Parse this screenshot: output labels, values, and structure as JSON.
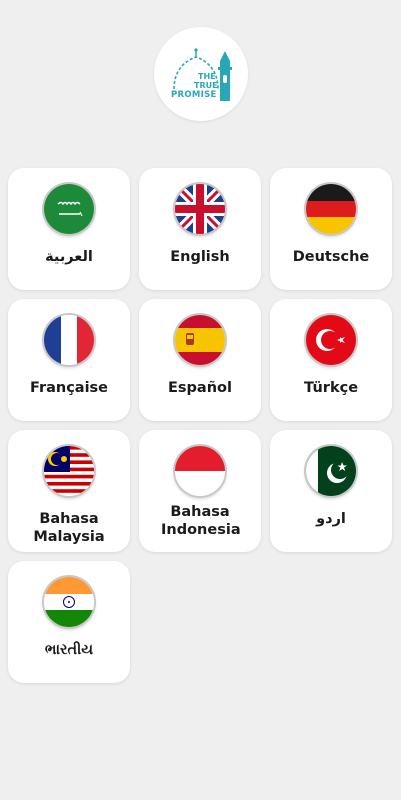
{
  "app": {
    "logo": {
      "name": "THE TRUE PROMISE",
      "line1": "THE",
      "line2": "TRUE",
      "line3": "PROMISE"
    }
  },
  "languages": [
    {
      "label": "العربية",
      "flag": "saudi-arabia-flag-icon"
    },
    {
      "label": "English",
      "flag": "uk-flag-icon"
    },
    {
      "label": "Deutsche",
      "flag": "germany-flag-icon"
    },
    {
      "label": "Française",
      "flag": "france-flag-icon"
    },
    {
      "label": "Español",
      "flag": "spain-flag-icon"
    },
    {
      "label": "Türkçe",
      "flag": "turkey-flag-icon"
    },
    {
      "label": "Bahasa Malaysia",
      "flag": "malaysia-flag-icon"
    },
    {
      "label": "Bahasa Indonesia",
      "flag": "indonesia-flag-icon"
    },
    {
      "label": "اردو",
      "flag": "pakistan-flag-icon"
    },
    {
      "label": "ભારતીય",
      "flag": "india-flag-icon"
    }
  ],
  "colors": {
    "background": "#efefef",
    "card": "#ffffff",
    "brand": "#2aa7b6",
    "text": "#1b1b1b"
  }
}
